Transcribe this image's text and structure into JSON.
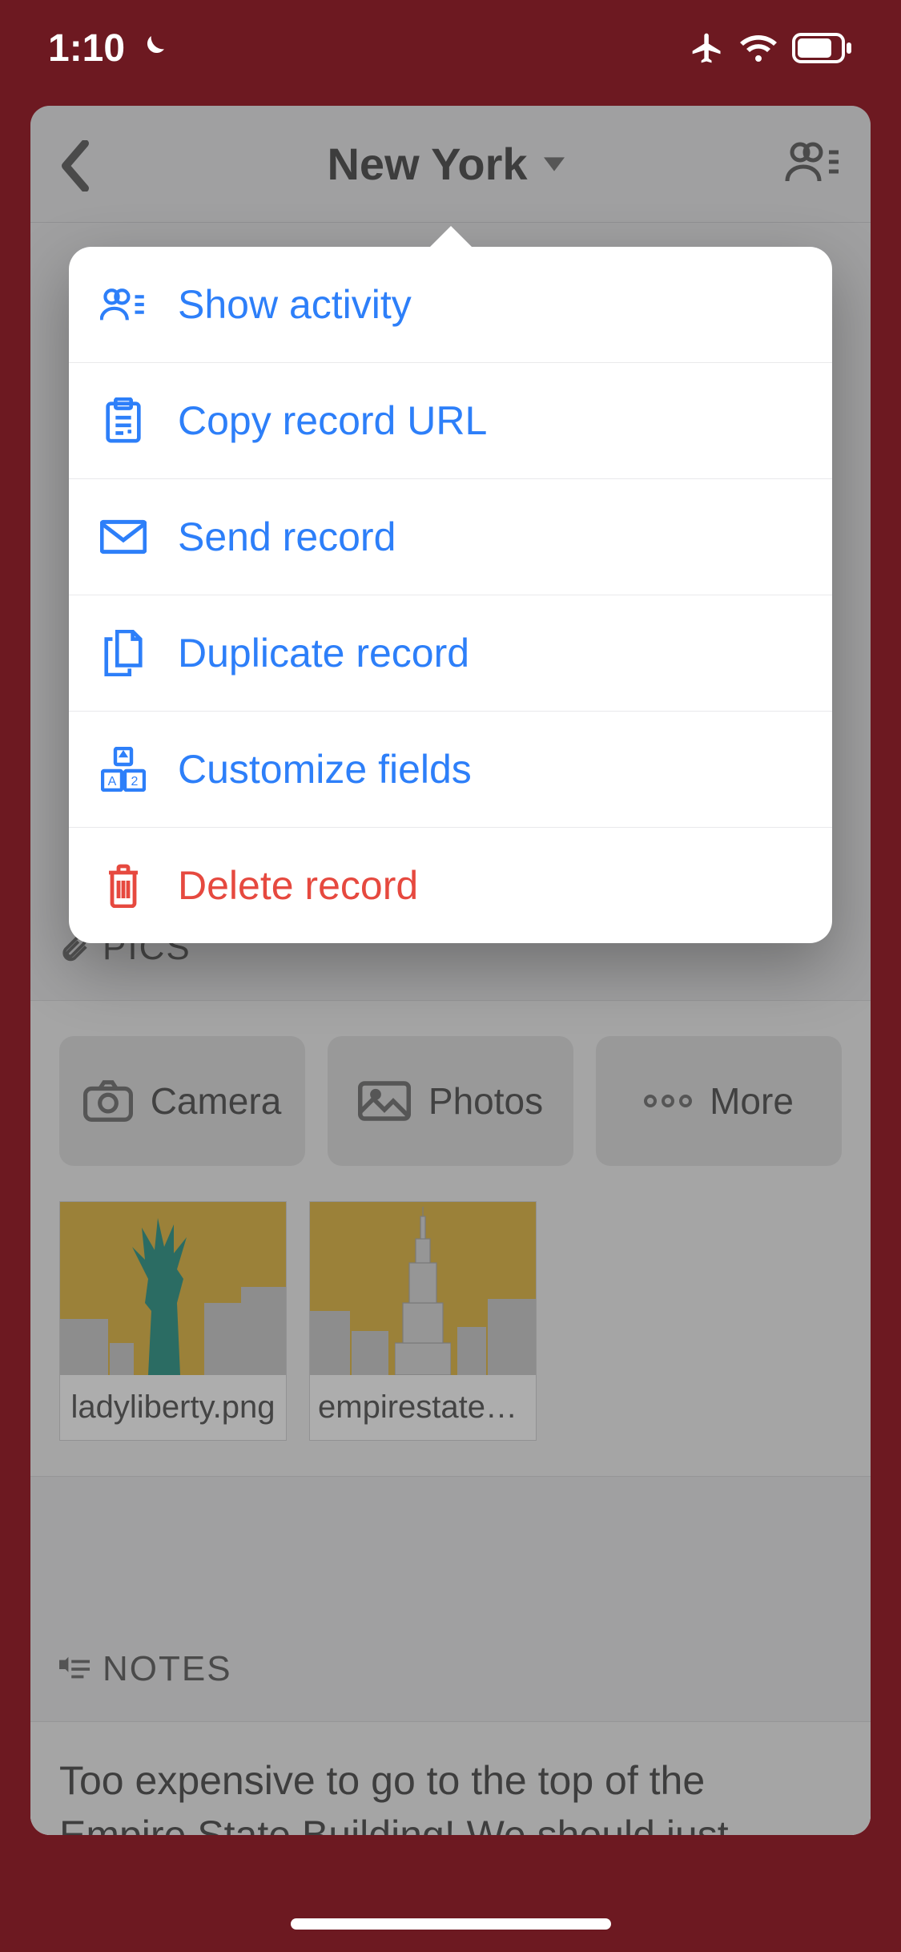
{
  "status": {
    "time": "1:10"
  },
  "header": {
    "title": "New York"
  },
  "menu": {
    "items": [
      {
        "label": "Show activity",
        "id": "show-activity"
      },
      {
        "label": "Copy record URL",
        "id": "copy-url"
      },
      {
        "label": "Send record",
        "id": "send-record"
      },
      {
        "label": "Duplicate record",
        "id": "duplicate-record"
      },
      {
        "label": "Customize fields",
        "id": "customize-fields"
      },
      {
        "label": "Delete record",
        "id": "delete-record",
        "danger": true
      }
    ]
  },
  "pics": {
    "heading": "PICS",
    "actions": {
      "camera": "Camera",
      "photos": "Photos",
      "more": "More"
    },
    "attachments": [
      {
        "filename": "ladyliberty.png"
      },
      {
        "filename": "empirestatebuild…"
      }
    ]
  },
  "notes": {
    "heading": "NOTES",
    "text": "Too expensive to go to the top of the Empire State Building! We should just"
  }
}
